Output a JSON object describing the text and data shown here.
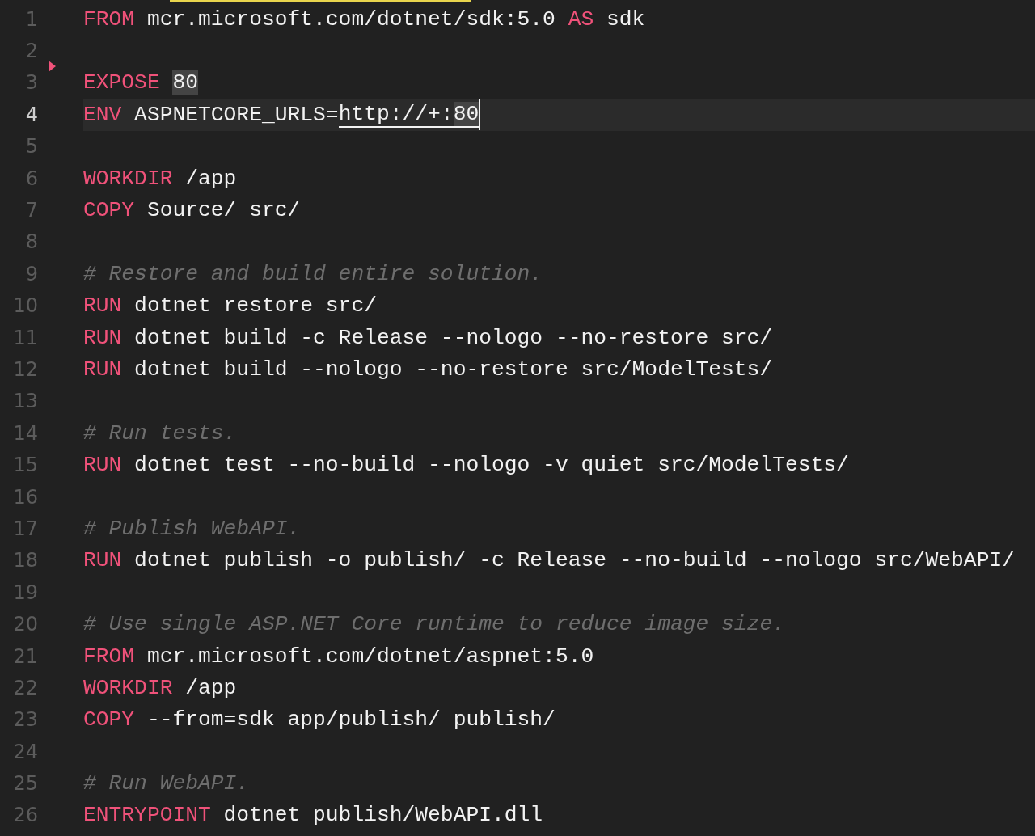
{
  "editor": {
    "lines": [
      {
        "number": "1",
        "current": false,
        "tokens": [
          {
            "kind": "keyword",
            "text": "FROM"
          },
          {
            "kind": "text",
            "text": " mcr.microsoft.com/dotnet/sdk:5.0 "
          },
          {
            "kind": "keyword",
            "text": "AS"
          },
          {
            "kind": "text",
            "text": " sdk"
          }
        ]
      },
      {
        "number": "2",
        "current": false
      },
      {
        "number": "3",
        "current": false,
        "tokens": [
          {
            "kind": "keyword",
            "text": "EXPOSE "
          },
          {
            "kind": "match",
            "text": "80"
          }
        ]
      },
      {
        "number": "4",
        "current": true,
        "tokens": [
          {
            "kind": "keyword",
            "text": "ENV"
          },
          {
            "kind": "text",
            "text": " ASPNETCORE_URLS="
          },
          {
            "kind": "link",
            "text": "http://+:"
          },
          {
            "kind": "link-match",
            "text": "80"
          }
        ]
      },
      {
        "number": "5",
        "current": false
      },
      {
        "number": "6",
        "current": false,
        "tokens": [
          {
            "kind": "keyword",
            "text": "WORKDIR"
          },
          {
            "kind": "text",
            "text": " /app"
          }
        ]
      },
      {
        "number": "7",
        "current": false,
        "tokens": [
          {
            "kind": "keyword",
            "text": "COPY"
          },
          {
            "kind": "text",
            "text": " Source/ src/"
          }
        ]
      },
      {
        "number": "8",
        "current": false
      },
      {
        "number": "9",
        "current": false,
        "tokens": [
          {
            "kind": "comment",
            "text": "# Restore and build entire solution."
          }
        ]
      },
      {
        "number": "10",
        "current": false,
        "tokens": [
          {
            "kind": "keyword",
            "text": "RUN"
          },
          {
            "kind": "text",
            "text": " dotnet restore src/"
          }
        ]
      },
      {
        "number": "11",
        "current": false,
        "tokens": [
          {
            "kind": "keyword",
            "text": "RUN"
          },
          {
            "kind": "text",
            "text": " dotnet build -c Release --nologo --no-restore src/"
          }
        ]
      },
      {
        "number": "12",
        "current": false,
        "tokens": [
          {
            "kind": "keyword",
            "text": "RUN"
          },
          {
            "kind": "text",
            "text": " dotnet build --nologo --no-restore src/ModelTests/"
          }
        ]
      },
      {
        "number": "13",
        "current": false
      },
      {
        "number": "14",
        "current": false,
        "tokens": [
          {
            "kind": "comment",
            "text": "# Run tests."
          }
        ]
      },
      {
        "number": "15",
        "current": false,
        "tokens": [
          {
            "kind": "keyword",
            "text": "RUN"
          },
          {
            "kind": "text",
            "text": " dotnet test --no-build --nologo -v quiet src/ModelTests/"
          }
        ]
      },
      {
        "number": "16",
        "current": false
      },
      {
        "number": "17",
        "current": false,
        "tokens": [
          {
            "kind": "comment",
            "text": "# Publish WebAPI."
          }
        ]
      },
      {
        "number": "18",
        "current": false,
        "tokens": [
          {
            "kind": "keyword",
            "text": "RUN"
          },
          {
            "kind": "text",
            "text": " dotnet publish -o publish/ -c Release --no-build --nologo src/WebAPI/"
          }
        ]
      },
      {
        "number": "19",
        "current": false
      },
      {
        "number": "20",
        "current": false,
        "tokens": [
          {
            "kind": "comment",
            "text": "# Use single ASP.NET Core runtime to reduce image size."
          }
        ]
      },
      {
        "number": "21",
        "current": false,
        "tokens": [
          {
            "kind": "keyword",
            "text": "FROM"
          },
          {
            "kind": "text",
            "text": " mcr.microsoft.com/dotnet/aspnet:5.0"
          }
        ]
      },
      {
        "number": "22",
        "current": false,
        "tokens": [
          {
            "kind": "keyword",
            "text": "WORKDIR"
          },
          {
            "kind": "text",
            "text": " /app"
          }
        ]
      },
      {
        "number": "23",
        "current": false,
        "tokens": [
          {
            "kind": "keyword",
            "text": "COPY"
          },
          {
            "kind": "text",
            "text": " --from=sdk app/publish/ publish/"
          }
        ]
      },
      {
        "number": "24",
        "current": false
      },
      {
        "number": "25",
        "current": false,
        "tokens": [
          {
            "kind": "comment",
            "text": "# Run WebAPI."
          }
        ]
      },
      {
        "number": "26",
        "current": false,
        "tokens": [
          {
            "kind": "keyword",
            "text": "ENTRYPOINT"
          },
          {
            "kind": "text",
            "text": " dotnet publish/WebAPI.dll"
          }
        ]
      }
    ]
  }
}
